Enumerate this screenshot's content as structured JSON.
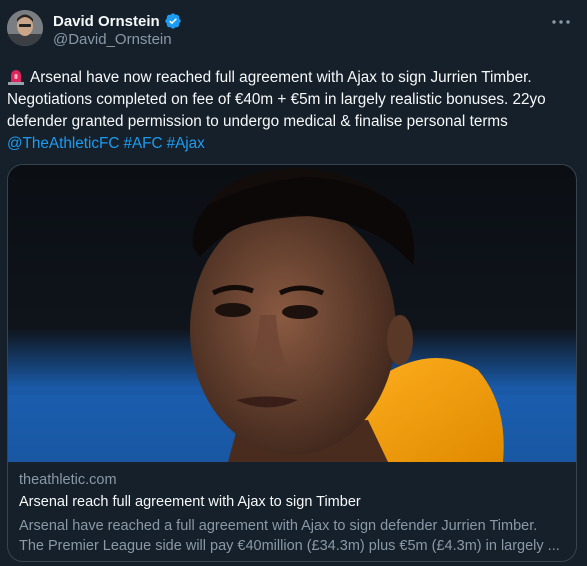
{
  "author": {
    "display_name": "David Ornstein",
    "handle": "@David_Ornstein",
    "verified": true
  },
  "tweet": {
    "text": "Arsenal have now reached full agreement with Ajax to sign Jurrien Timber. Negotiations completed on fee of €40m + €5m in largely realistic bonuses. 22yo defender granted permission to undergo medical & finalise personal terms",
    "tags": [
      "@TheAthleticFC",
      "#AFC",
      "#Ajax"
    ]
  },
  "card": {
    "domain": "theathletic.com",
    "title": "Arsenal reach full agreement with Ajax to sign Timber",
    "description": "Arsenal have reached a full agreement with Ajax to sign defender Jurrien Timber. The Premier League side will pay €40million (£34.3m) plus €5m (£4.3m) in largely ..."
  },
  "icons": {
    "alarm": "rotating-light-icon",
    "verified": "verified-badge-icon",
    "more": "more-options-icon"
  },
  "colors": {
    "background": "#15202b",
    "link": "#1d9bf0",
    "secondary_text": "#8b98a5",
    "verified_badge": "#1d9bf0"
  }
}
